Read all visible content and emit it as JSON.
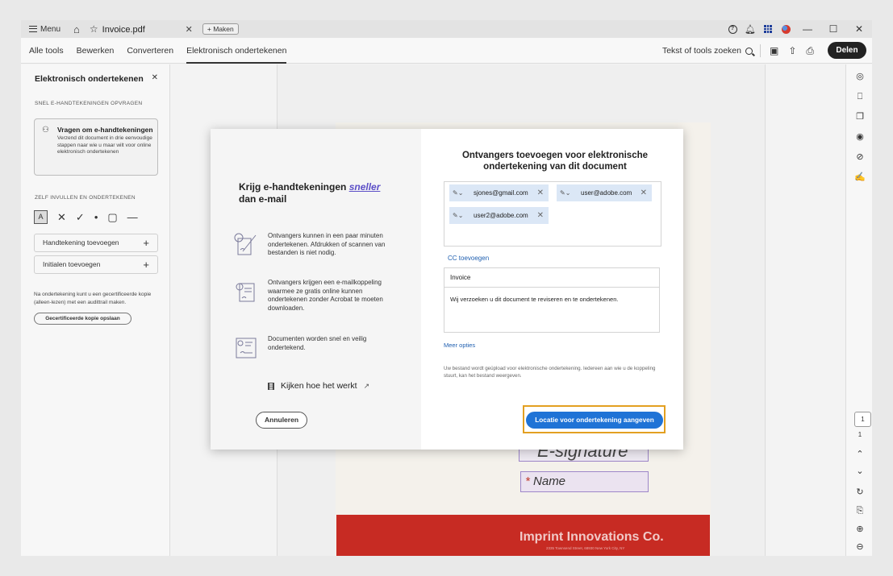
{
  "titlebar": {
    "menu_label": "Menu",
    "tab_title": "Invoice.pdf",
    "new_tab_label": "+ Maken"
  },
  "toolbar": {
    "tabs": [
      "Alle tools",
      "Bewerken",
      "Converteren",
      "Elektronisch ondertekenen"
    ],
    "active_tab": "Elektronisch ondertekenen",
    "search_label": "Tekst of tools zoeken",
    "share_label": "Delen"
  },
  "left_panel": {
    "title": "Elektronisch ondertekenen",
    "section_request": "SNEL E-HANDTEKENINGEN OPVRAGEN",
    "request_card": {
      "title": "Vragen om e-handtekeningen",
      "desc": "Verzend dit document in drie eenvoudige stappen naar wie u maar wilt voor online elektronisch ondertekenen"
    },
    "section_self": "ZELF INVULLEN EN ONDERTEKENEN",
    "tool_a_label": "A",
    "add_signature": "Handtekening toevoegen",
    "add_initials": "Initialen toevoegen",
    "note": "Na ondertekening kunt u een gecertificeerde kopie (alleen-lezen) met een audittrail maken.",
    "save_certified": "Gecertificeerde kopie opslaan"
  },
  "document": {
    "signature_text": "E-signature",
    "name_placeholder": "Name",
    "footer_company": "Imprint Innovations Co.",
    "footer_address": "2335 Townsend Street, 68930 New York City, NY"
  },
  "right_rail": {
    "page_input": "1",
    "page_total": "1"
  },
  "modal": {
    "headline_part1": "Krijg e-handtekeningen ",
    "headline_accent": "sneller",
    "headline_part2": "dan e-mail",
    "features": [
      "Ontvangers kunnen in een paar minuten ondertekenen. Afdrukken of scannen van bestanden is niet nodig.",
      "Ontvangers krijgen een e-mailkoppeling waarmee ze gratis online kunnen ondertekenen zonder Acrobat te moeten downloaden.",
      "Documenten worden snel en veilig ondertekend."
    ],
    "watch_label": "Kijken hoe het werkt",
    "title": "Ontvangers toevoegen voor elektronische ondertekening van dit document",
    "recipients": [
      "sjones@gmail.com",
      "user@adobe.com",
      "user2@adobe.com"
    ],
    "cc_label": "CC toevoegen",
    "subject": "Invoice",
    "message": "Wij verzoeken u dit document te reviseren en te ondertekenen.",
    "more_options": "Meer opties",
    "info": "Uw bestand wordt geüpload voor elektronische ondertekening. Iedereen aan wie u de koppeling stuurt, kan het bestand weergeven.",
    "cancel_label": "Annuleren",
    "primary_label": "Locatie voor ondertekening aangeven"
  },
  "colors": {
    "primary_button": "#1f73d6",
    "focus_outline": "#e3a021",
    "accent_text": "#5b4ec7",
    "chip_bg": "#dbe7f6",
    "footer_red": "#c72b23"
  }
}
